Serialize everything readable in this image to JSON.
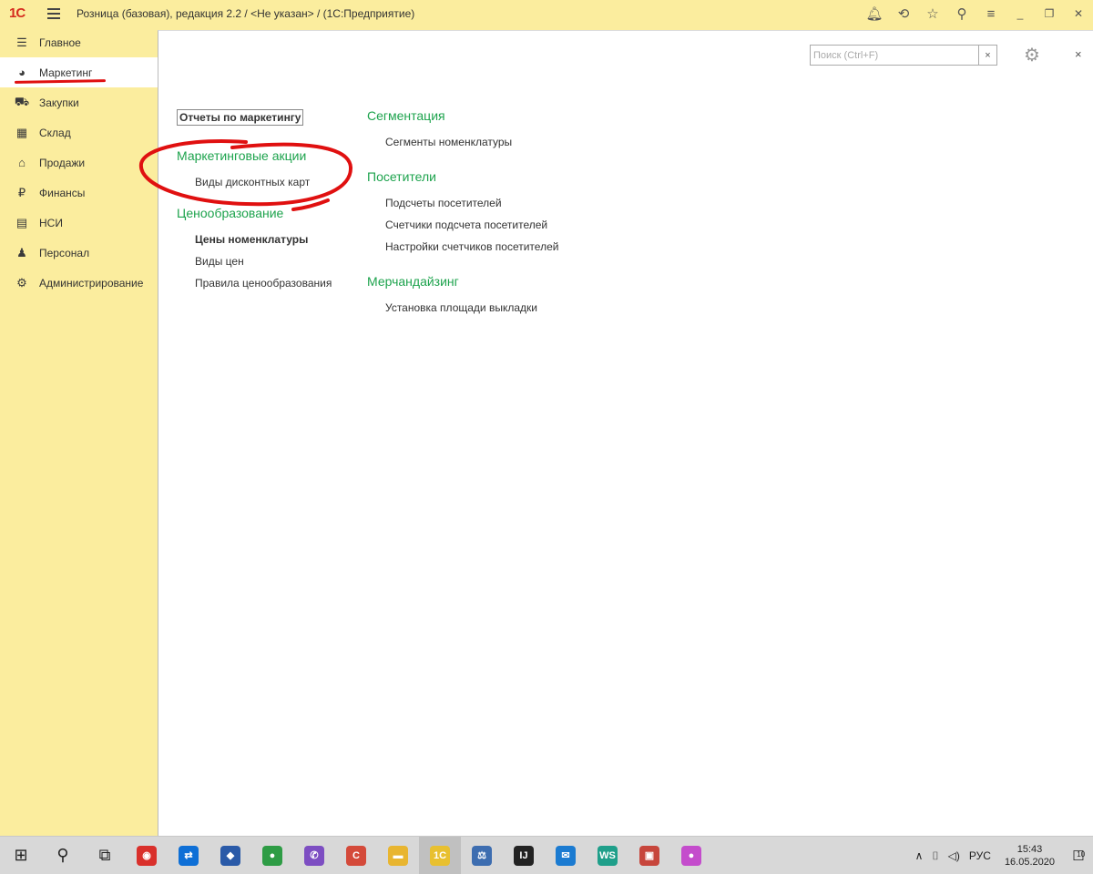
{
  "titlebar": {
    "logo": "1С",
    "title": "Розница (базовая), редакция 2.2 / <Не указан> /  (1С:Предприятие)",
    "icons": [
      "bell-icon",
      "history-icon",
      "star-icon",
      "search-icon",
      "settings-icon",
      "minimize-icon",
      "restore-icon",
      "close-icon"
    ]
  },
  "sidebar": {
    "items": [
      {
        "label": "Главное",
        "icon": "menu-icon",
        "glyph": "☰"
      },
      {
        "label": "Маркетинг",
        "icon": "pie-chart-icon",
        "glyph": "◕"
      },
      {
        "label": "Закупки",
        "icon": "cart-icon",
        "glyph": "⛟"
      },
      {
        "label": "Склад",
        "icon": "warehouse-icon",
        "glyph": "▦"
      },
      {
        "label": "Продажи",
        "icon": "basket-icon",
        "glyph": "⌂"
      },
      {
        "label": "Финансы",
        "icon": "ruble-icon",
        "glyph": "₽"
      },
      {
        "label": "НСИ",
        "icon": "catalog-icon",
        "glyph": "▤"
      },
      {
        "label": "Персонал",
        "icon": "person-icon",
        "glyph": "♟"
      },
      {
        "label": "Администрирование",
        "icon": "gear-icon",
        "glyph": "⚙"
      }
    ],
    "active_index": 1
  },
  "main": {
    "search_placeholder": "Поиск (Ctrl+F)",
    "search_clear": "×",
    "close_label": "×",
    "col1": {
      "report_button": "Отчеты по маркетингу",
      "groups": [
        {
          "title": "Маркетинговые акции",
          "links": [
            {
              "label": "Виды дисконтных карт",
              "bold": false
            }
          ]
        },
        {
          "title": "Ценообразование",
          "links": [
            {
              "label": "Цены номенклатуры",
              "bold": true
            },
            {
              "label": "Виды цен",
              "bold": false
            },
            {
              "label": "Правила ценообразования",
              "bold": false
            }
          ]
        }
      ]
    },
    "col2": {
      "groups": [
        {
          "title": "Сегментация",
          "links": [
            {
              "label": "Сегменты номенклатуры"
            }
          ]
        },
        {
          "title": "Посетители",
          "links": [
            {
              "label": "Подсчеты посетителей"
            },
            {
              "label": "Счетчики подсчета посетителей"
            },
            {
              "label": "Настройки счетчиков посетителей"
            }
          ]
        },
        {
          "title": "Мерчандайзинг",
          "links": [
            {
              "label": "Установка площади выкладки"
            }
          ]
        }
      ]
    }
  },
  "taskbar": {
    "apps": [
      {
        "name": "start-button",
        "glyph": "⊞"
      },
      {
        "name": "search-button",
        "glyph": "⚲"
      },
      {
        "name": "task-view-button",
        "glyph": "⧉"
      },
      {
        "name": "app-red",
        "glyph": "◉",
        "color": "#d9302b"
      },
      {
        "name": "app-teamviewer",
        "glyph": "⇄",
        "color": "#0e6fd6"
      },
      {
        "name": "app-blue",
        "glyph": "◆",
        "color": "#2a5aa8"
      },
      {
        "name": "app-chrome",
        "glyph": "●",
        "color": "#2e9c45"
      },
      {
        "name": "app-viber",
        "glyph": "✆",
        "color": "#7d4ec2"
      },
      {
        "name": "app-c",
        "glyph": "C",
        "color": "#d44a3a"
      },
      {
        "name": "app-explorer",
        "glyph": "▬",
        "color": "#e8b530"
      },
      {
        "name": "app-1c",
        "glyph": "1С",
        "color": "#e8c030",
        "active": true
      },
      {
        "name": "app-fns",
        "glyph": "⚖",
        "color": "#3d6db0"
      },
      {
        "name": "app-intellij",
        "glyph": "IJ",
        "color": "#222222"
      },
      {
        "name": "app-mail",
        "glyph": "✉",
        "color": "#1b7bd1"
      },
      {
        "name": "app-webstorm",
        "glyph": "WS",
        "color": "#1f9f8a"
      },
      {
        "name": "app-game",
        "glyph": "▣",
        "color": "#c7463c"
      },
      {
        "name": "app-drop",
        "glyph": "●",
        "color": "#c44ccc"
      }
    ],
    "tray": {
      "chevron": "∧",
      "network": "⌷",
      "volume": "◁)",
      "lang": "РУС",
      "time": "15:43",
      "date": "16.05.2020",
      "notification_count": "10"
    }
  }
}
